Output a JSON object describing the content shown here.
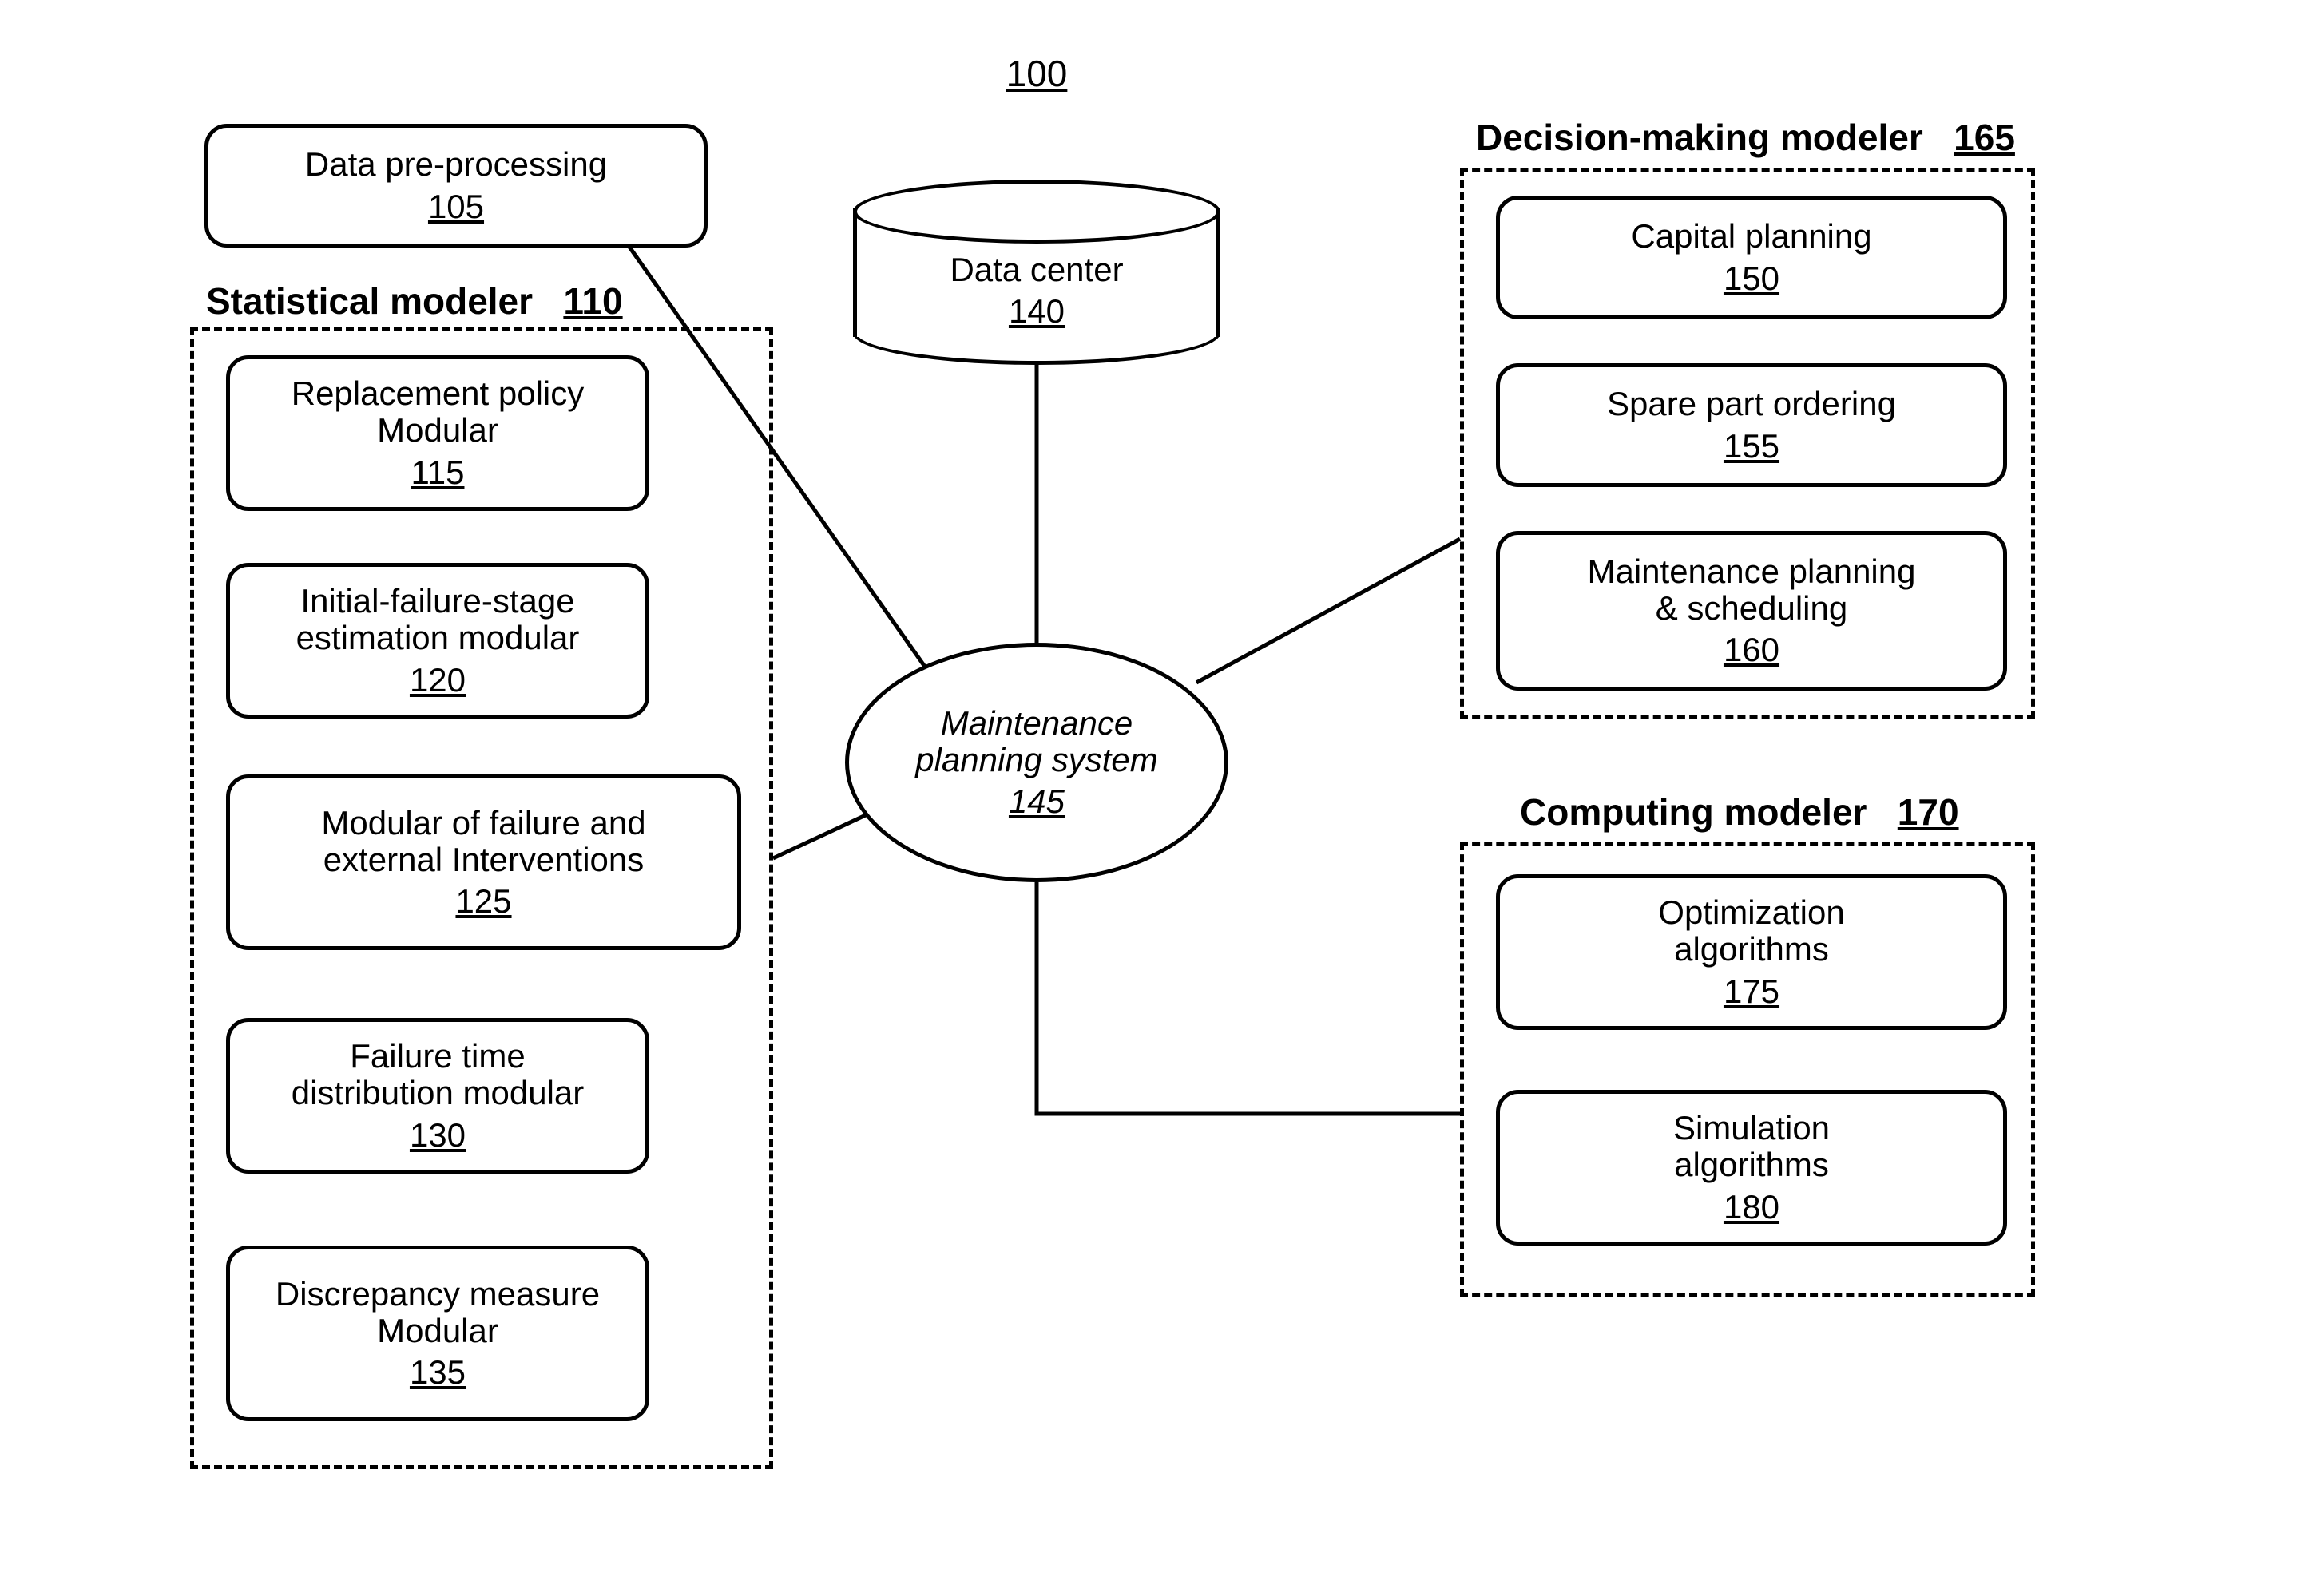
{
  "diagram": {
    "id": "100",
    "preprocessing": {
      "label": "Data pre-processing",
      "id": "105"
    },
    "statistical": {
      "title": "Statistical modeler",
      "id": "110",
      "items": [
        {
          "label": "Replacement policy\nModular",
          "id": "115"
        },
        {
          "label": "Initial-failure-stage\nestimation modular",
          "id": "120"
        },
        {
          "label": "Modular of failure and\nexternal Interventions",
          "id": "125"
        },
        {
          "label": "Failure time\ndistribution modular",
          "id": "130"
        },
        {
          "label": "Discrepancy measure\nModular",
          "id": "135"
        }
      ]
    },
    "datacenter": {
      "label": "Data center",
      "id": "140"
    },
    "mps": {
      "label": "Maintenance\nplanning system",
      "id": "145"
    },
    "decision": {
      "title": "Decision-making modeler",
      "id": "165",
      "items": [
        {
          "label": "Capital planning",
          "id": "150"
        },
        {
          "label": "Spare part ordering",
          "id": "155"
        },
        {
          "label": "Maintenance planning\n& scheduling",
          "id": "160"
        }
      ]
    },
    "computing": {
      "title": "Computing  modeler",
      "id": "170",
      "items": [
        {
          "label": "Optimization\nalgorithms",
          "id": "175"
        },
        {
          "label": "Simulation\nalgorithms",
          "id": "180"
        }
      ]
    }
  }
}
